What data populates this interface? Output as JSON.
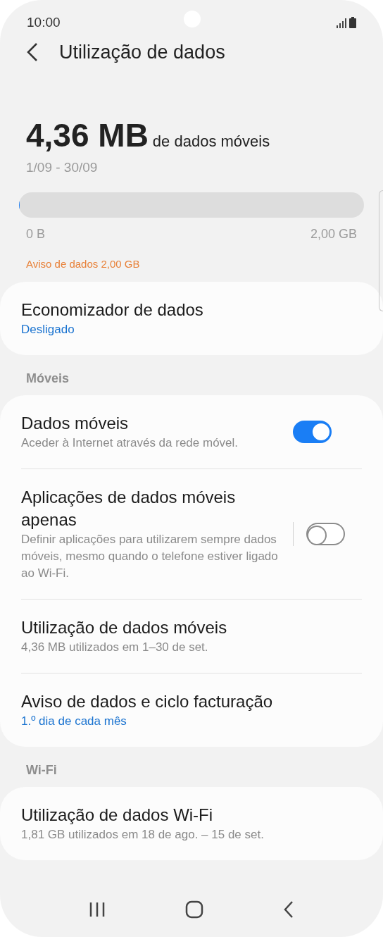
{
  "status_bar": {
    "time": "10:00"
  },
  "header": {
    "title": "Utilização de dados"
  },
  "usage": {
    "amount": "4,36 MB",
    "unit_label": "de dados móveis",
    "period": "1/09 - 30/09",
    "level": 0.002,
    "min_label": "0 B",
    "max_label": "2,00 GB",
    "warning": "Aviso de dados 2,00 GB"
  },
  "sections": [
    {
      "rows": [
        {
          "kind": "link",
          "title": "Economizador de dados",
          "summary": "Desligado",
          "accent": true
        }
      ]
    },
    {
      "heading": "Móveis",
      "rows": [
        {
          "kind": "toggle",
          "title": "Dados móveis",
          "summary": "Aceder à Internet através da rede móvel.",
          "accent": false,
          "on": true,
          "divider": false
        },
        {
          "kind": "toggle",
          "title": "Aplicações de dados móveis apenas",
          "summary": "Definir aplicações para utilizarem sempre dados móveis, mesmo quando o telefone estiver ligado ao Wi-Fi.",
          "accent": false,
          "on": false,
          "divider": true
        },
        {
          "kind": "link",
          "title": "Utilização de dados móveis",
          "summary": "4,36 MB utilizados em 1–30 de set.",
          "accent": false
        },
        {
          "kind": "link",
          "title": "Aviso de dados e ciclo facturação",
          "summary": "1.º dia de cada mês",
          "accent": true
        }
      ]
    },
    {
      "heading": "Wi-Fi",
      "rows": [
        {
          "kind": "link",
          "title": "Utilização de dados Wi-Fi",
          "summary": "1,81 GB utilizados em 18 de ago. – 15 de set.",
          "accent": false
        }
      ]
    }
  ]
}
